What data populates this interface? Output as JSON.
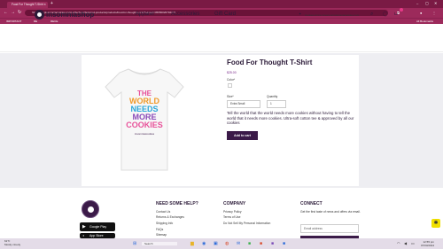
{
  "browser": {
    "tab_title": "Food For Thought T-Shirt",
    "url": "https://shopinsomniacookies.com/collections/featured-products/products/food-for-thought-t-shirt?variant=45650020794471",
    "bookmarks": [
      "IMPORTANT",
      "RE",
      "RECE"
    ],
    "all_bookmarks": "All Bookmarks"
  },
  "site": {
    "logo_text": "insomniashop",
    "nav": [
      "Apparel",
      "Accessories",
      "Gift Card"
    ],
    "promo": "Cookies & Ice Cream at insomniacookies.com"
  },
  "product": {
    "title": "Food For Thought T-Shirt",
    "price": "$25.00",
    "color_label": "Color*",
    "size_label": "Size*",
    "size_value": "Extra Small",
    "quantity_label": "Quantity",
    "quantity_value": "1",
    "description": "Tell the world that the world needs more cookies without having to tell the world that it needs more cookies. Ultra-soft cotton tee & approved by all our cookies",
    "add_to_cart": "Add to cart",
    "shirt_lines": [
      "THE",
      "WORLD",
      "NEEDS",
      "MORE",
      "COOKIES"
    ],
    "shirt_tag": "insomniacookies"
  },
  "footer": {
    "store_buttons": [
      "Google Play",
      "App Store"
    ],
    "help_heading": "NEED SOME HELP?",
    "help_links": [
      "Contact Us",
      "Returns & Exchanges",
      "Shipping Info",
      "FAQs",
      "Sitemap"
    ],
    "company_heading": "COMPANY",
    "company_links": [
      "Privacy Policy",
      "Terms of Use",
      "Do Not Sell My Personal Information"
    ],
    "connect_heading": "CONNECT",
    "connect_text": "Get the first taste of news and offers via email.",
    "email_placeholder": "Email address"
  },
  "taskbar": {
    "weather_temp": "61°F",
    "weather_desc": "Mostly cloudy",
    "search_placeholder": "Search",
    "time": "12:55 pm",
    "date": "07/03/2024"
  },
  "colors": {
    "browser_tab": "#7a1a44",
    "brand_dark": "#2b1a38",
    "button": "#3b1a48",
    "accent": "#e63987"
  }
}
